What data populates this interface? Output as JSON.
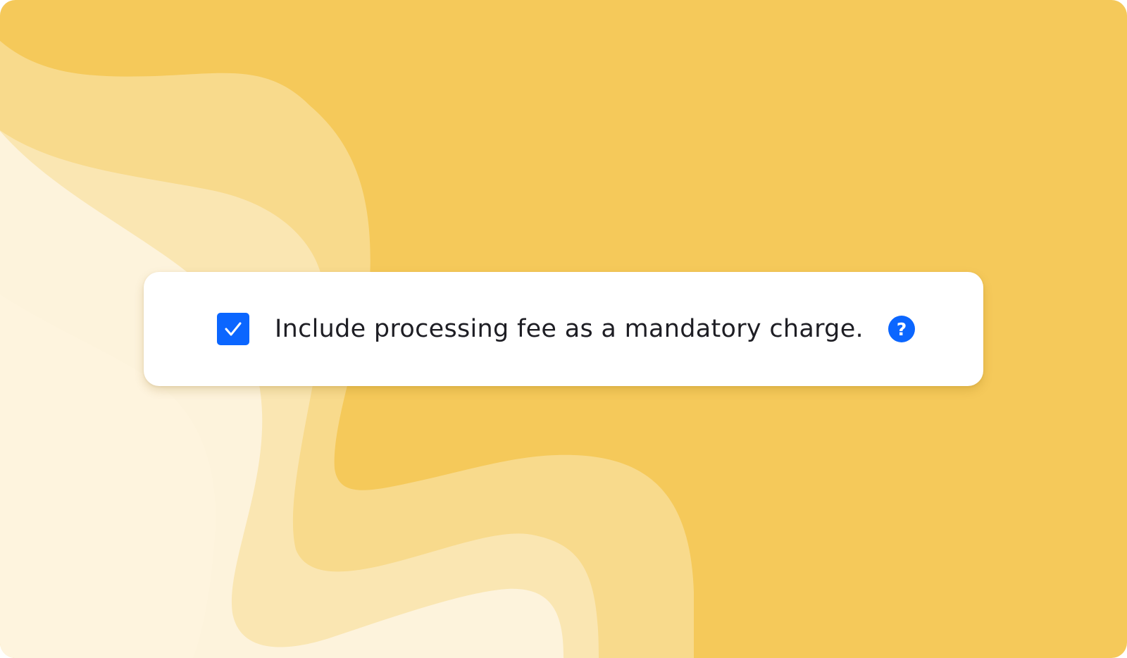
{
  "colors": {
    "background": "#F5C95A",
    "wave_light_1": "#F8DA8C",
    "wave_light_2": "#FAE6B2",
    "wave_light_3": "#FDF3DC",
    "card": "#FFFFFF",
    "accent": "#0B66FF",
    "text": "#1E1E24"
  },
  "option": {
    "checked": true,
    "label": "Include processing fee as a mandatory charge.",
    "checkbox_icon": "checkmark-icon",
    "help_icon": "question-circle-icon",
    "help_glyph": "?"
  }
}
